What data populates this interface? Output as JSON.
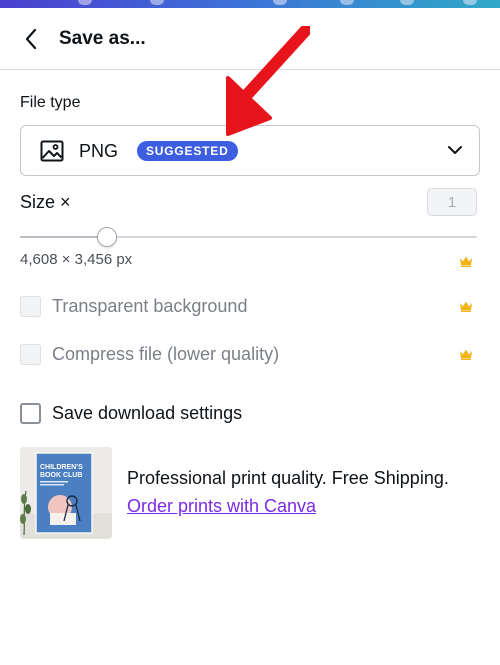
{
  "header": {
    "title": "Save as...",
    "back_icon": "chevron-left-icon"
  },
  "file_type": {
    "label": "File type",
    "value": "PNG",
    "badge": "SUGGESTED",
    "icon": "image-icon",
    "dropdown_icon": "chevron-down-icon"
  },
  "size": {
    "label": "Size ×",
    "input_value": "1",
    "dimensions": "4,608 × 3,456 px",
    "slider_value_fraction": 0.19,
    "premium_icon": "crown-icon"
  },
  "options": [
    {
      "label": "Transparent background",
      "checked": false,
      "disabled": true,
      "premium": true
    },
    {
      "label": "Compress file (lower quality)",
      "checked": false,
      "disabled": true,
      "premium": true
    },
    {
      "label": "Save download settings",
      "checked": false,
      "disabled": false,
      "premium": false
    }
  ],
  "promo": {
    "text": "Professional print quality. Free Shipping.",
    "link": "Order prints with Canva",
    "thumbnail_title": "CHILDREN’S BOOK CLUB"
  },
  "colors": {
    "accent": "#3d5ee1",
    "link": "#7d2ae8",
    "crown": "#f2b314",
    "annotation_arrow": "#e8141c"
  }
}
